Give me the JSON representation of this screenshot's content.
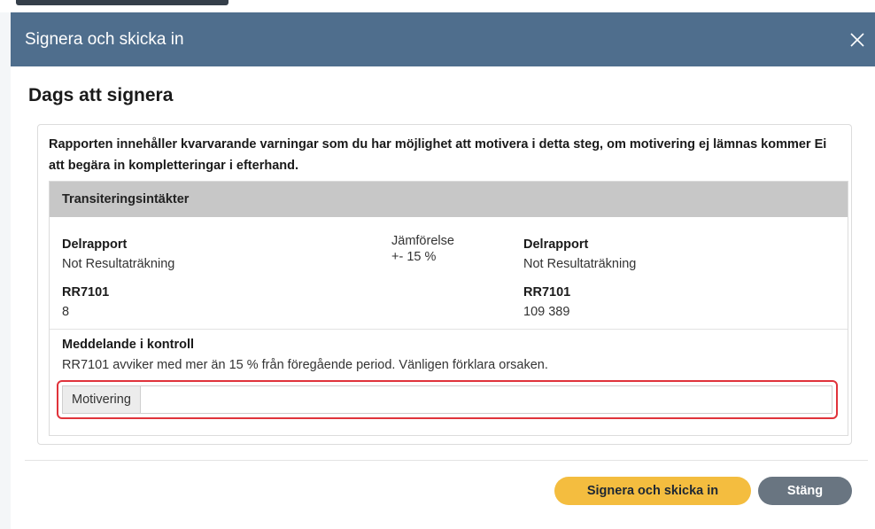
{
  "dialog": {
    "title": "Signera och skicka in",
    "heading": "Dags att signera"
  },
  "warning": {
    "intro": "Rapporten innehåller kvarvarande varningar som du har möjlighet att motivera i detta steg, om motivering ej lämnas kommer Ei att begära in kompletteringar i efterhand.",
    "category": "Transiteringsintäkter",
    "left": {
      "report_label": "Delrapport",
      "report_value": "Not Resultaträkning",
      "code_label": "RR7101",
      "code_value": "8"
    },
    "comparison": {
      "label": "Jämförelse",
      "value": "+- 15 %"
    },
    "right": {
      "report_label": "Delrapport",
      "report_value": "Not Resultaträkning",
      "code_label": "RR7101",
      "code_value": "109 389"
    },
    "message_title": "Meddelande i kontroll",
    "message_text": "RR7101 avviker med mer än 15 % från föregående period. Vänligen förklara orsaken.",
    "motivation_label": "Motivering",
    "motivation_value": ""
  },
  "footer": {
    "sign_label": "Signera och skicka in",
    "close_label": "Stäng"
  },
  "colors": {
    "header": "#4f6e8d",
    "sign_button": "#f4bd3f",
    "close_button": "#697581",
    "highlight": "#e0333b"
  },
  "icons": {
    "close": "close-icon"
  }
}
